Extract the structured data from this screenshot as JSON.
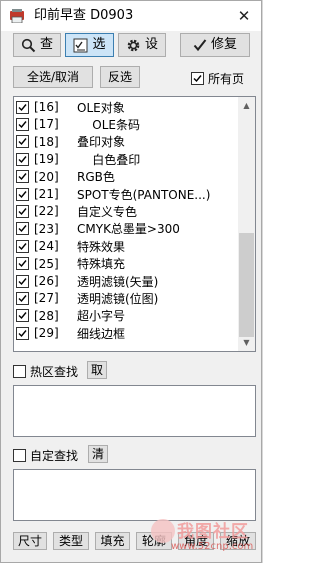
{
  "window": {
    "title": "印前早查 D0903",
    "close_glyph": "✕"
  },
  "toolbar": {
    "check_label": "查",
    "select_label": "选",
    "settings_label": "设",
    "fix_label": "修复"
  },
  "actions": {
    "select_all_label": "全选/取消",
    "invert_label": "反选",
    "all_pages_label": "所有页",
    "all_pages_checked": true
  },
  "checklist": {
    "items": [
      {
        "index": "[16]",
        "label": "OLE对象",
        "checked": true
      },
      {
        "index": "[17]",
        "label": "    OLE条码",
        "checked": true
      },
      {
        "index": "[18]",
        "label": "叠印对象",
        "checked": true
      },
      {
        "index": "[19]",
        "label": "    白色叠印",
        "checked": true
      },
      {
        "index": "[20]",
        "label": "RGB色",
        "checked": true
      },
      {
        "index": "[21]",
        "label": "SPOT专色(PANTONE...)",
        "checked": true
      },
      {
        "index": "[22]",
        "label": "自定义专色",
        "checked": true
      },
      {
        "index": "[23]",
        "label": "CMYK总墨量>300",
        "checked": true
      },
      {
        "index": "[24]",
        "label": "特殊效果",
        "checked": true
      },
      {
        "index": "[25]",
        "label": "特殊填充",
        "checked": true
      },
      {
        "index": "[26]",
        "label": "透明滤镜(矢量)",
        "checked": true
      },
      {
        "index": "[27]",
        "label": "透明滤镜(位图)",
        "checked": true
      },
      {
        "index": "[28]",
        "label": "超小字号",
        "checked": true
      },
      {
        "index": "[29]",
        "label": "细线边框",
        "checked": true
      }
    ]
  },
  "hotzone": {
    "label": "热区查找",
    "checked": false,
    "fetch_label": "取",
    "text": ""
  },
  "custom_search": {
    "label": "自定查找",
    "checked": false,
    "clear_label": "清",
    "text": ""
  },
  "bottom_buttons": [
    "尺寸",
    "类型",
    "填充",
    "轮廓",
    "角度",
    "缩放"
  ],
  "watermark": {
    "text": "我图社区",
    "url": "www.52cnp.com"
  }
}
